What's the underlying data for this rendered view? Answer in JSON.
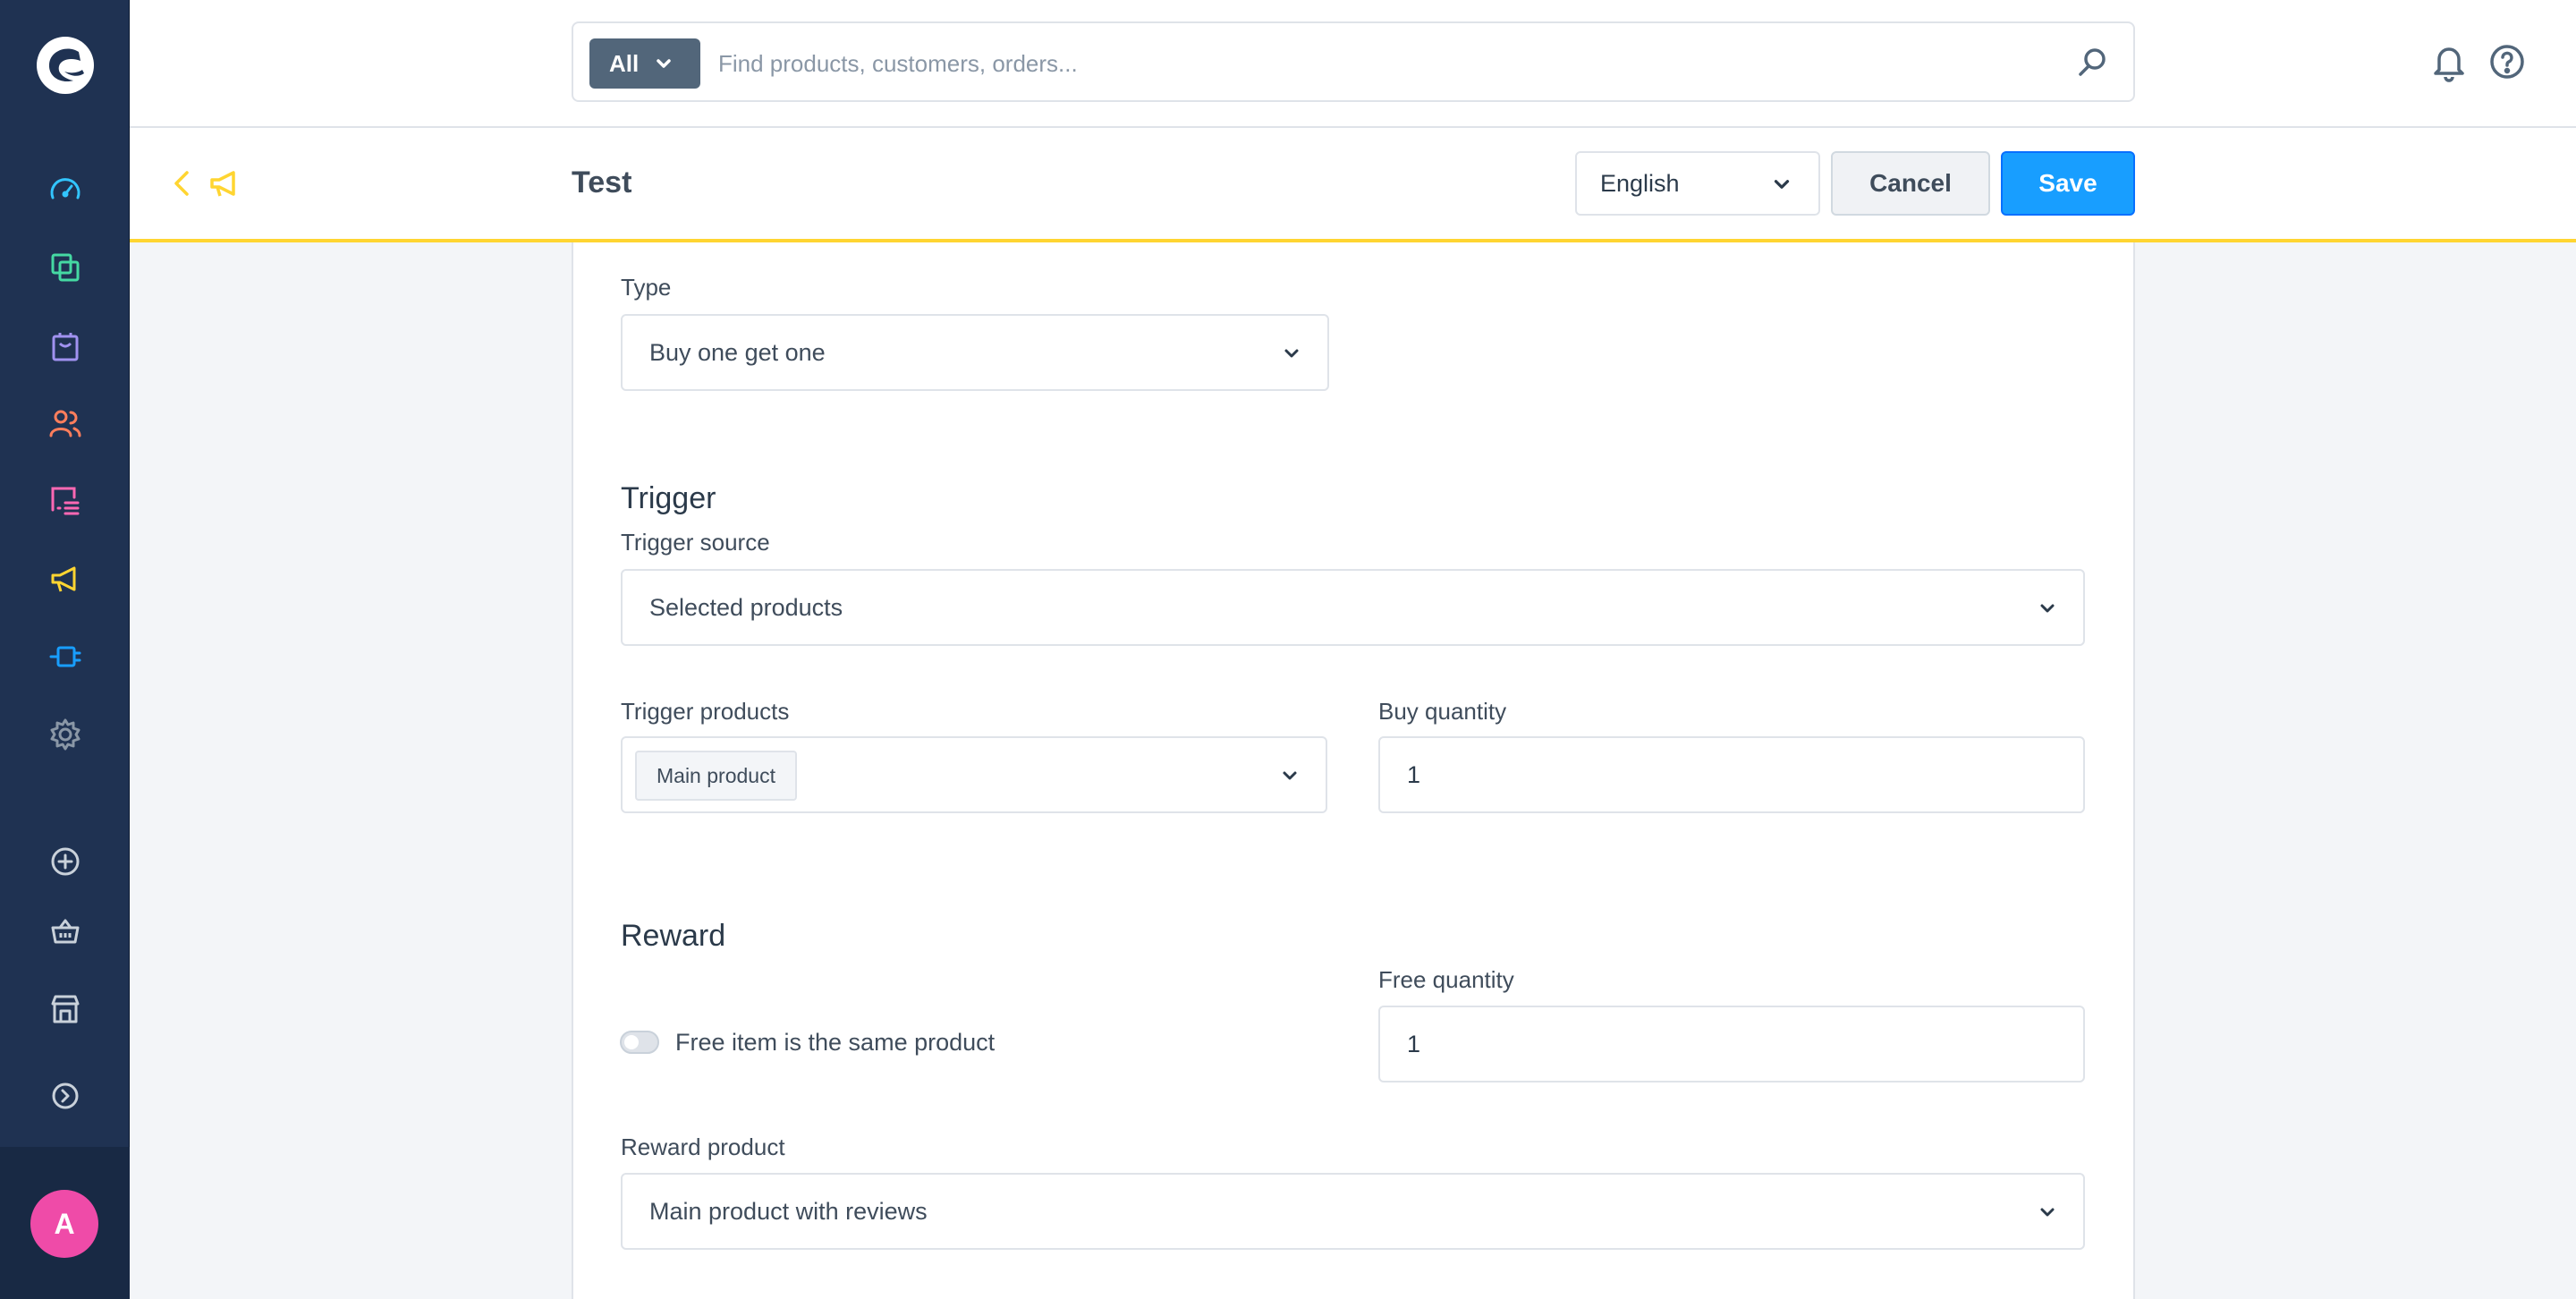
{
  "search": {
    "scope_label": "All",
    "placeholder": "Find products, customers, orders..."
  },
  "smartbar": {
    "title": "Test",
    "language": "English",
    "cancel_label": "Cancel",
    "save_label": "Save"
  },
  "user": {
    "avatar_initial": "A"
  },
  "colors": {
    "sidebar_bg": "#1f3252",
    "accent_yellow": "#ffd531",
    "primary_blue": "#189eff",
    "avatar_pink": "#ef4ba8"
  },
  "sidebar": {
    "items": [
      {
        "name": "dashboard-icon"
      },
      {
        "name": "catalogues-icon"
      },
      {
        "name": "orders-icon"
      },
      {
        "name": "customers-icon"
      },
      {
        "name": "content-icon"
      },
      {
        "name": "marketing-icon"
      },
      {
        "name": "extensions-icon"
      },
      {
        "name": "settings-icon"
      },
      {
        "name": "add-icon"
      },
      {
        "name": "basket-icon"
      },
      {
        "name": "storefront-icon"
      },
      {
        "name": "expand-icon"
      }
    ]
  },
  "form": {
    "type": {
      "label": "Type",
      "value": "Buy one get one"
    },
    "trigger": {
      "title": "Trigger",
      "source_label": "Trigger source",
      "source_value": "Selected products",
      "products_label": "Trigger products",
      "products_tag": "Main product",
      "buy_quantity_label": "Buy quantity",
      "buy_quantity_value": "1"
    },
    "reward": {
      "title": "Reward",
      "toggle_label": "Free item is the same product",
      "free_quantity_label": "Free quantity",
      "free_quantity_value": "1",
      "product_label": "Reward product",
      "product_value": "Main product with reviews"
    }
  }
}
